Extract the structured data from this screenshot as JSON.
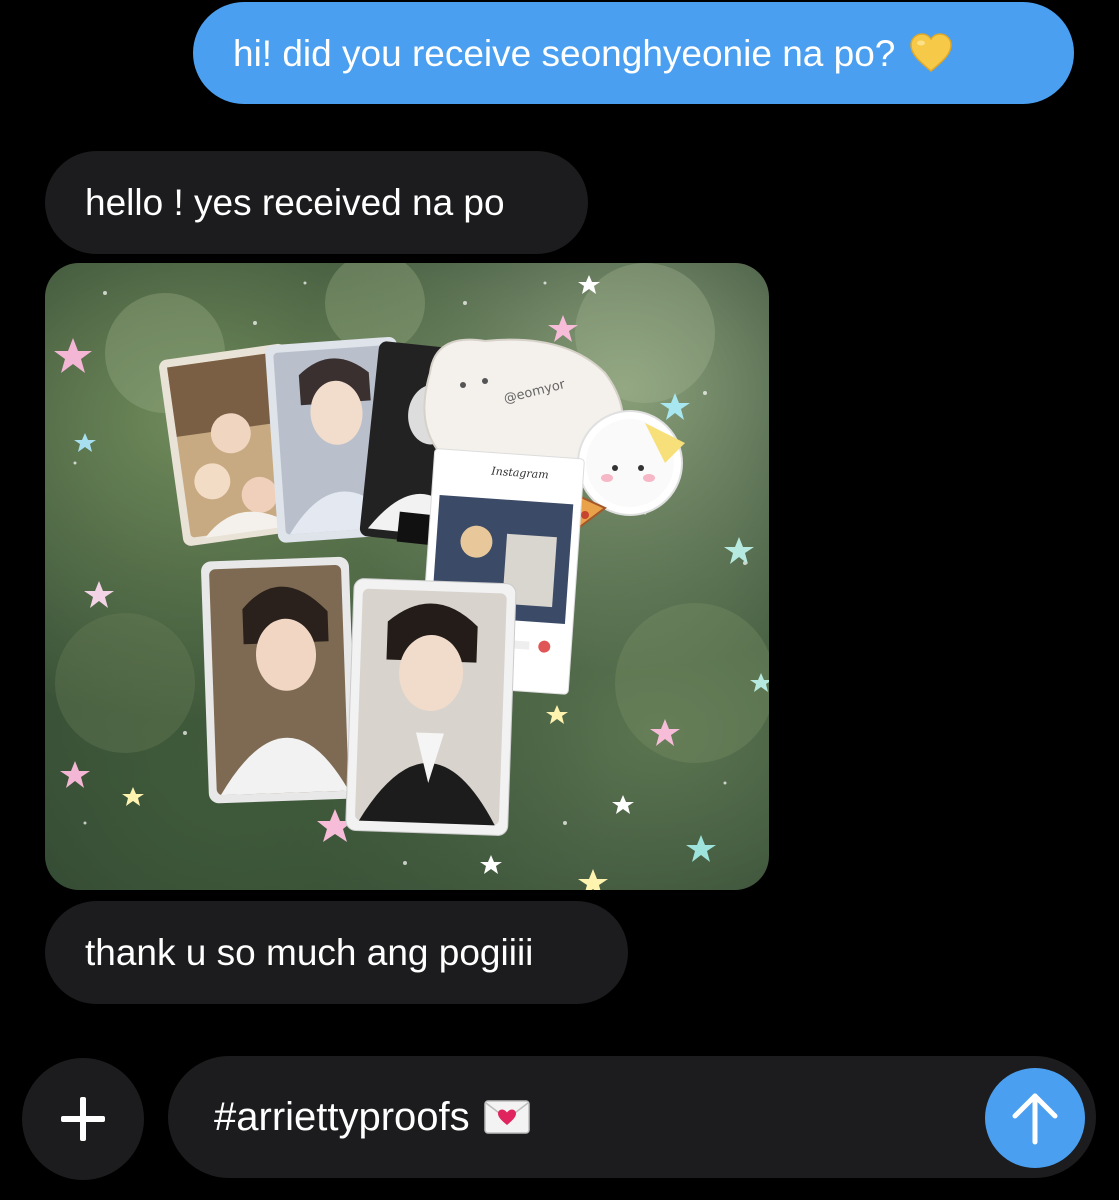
{
  "conversation": {
    "messages": [
      {
        "direction": "sent",
        "text": "hi! did you receive seonghyeonie na po?",
        "emoji": "yellow-heart"
      },
      {
        "direction": "received",
        "text": "hello ! yes received na po"
      },
      {
        "direction": "received",
        "type": "photo",
        "handle": "@eomyor",
        "caption_text": "Instagram"
      },
      {
        "direction": "received",
        "text": "thank u so much ang pogiiii"
      }
    ]
  },
  "composer": {
    "add_icon": "plus-icon",
    "text": "#arriettyproofs",
    "emoji": "love-letter",
    "send_icon": "arrow-up-icon"
  },
  "colors": {
    "sent_bubble": "#4a9ff0",
    "received_bubble": "#1c1c1e",
    "background": "#000000",
    "send_button": "#4a9ff0"
  }
}
